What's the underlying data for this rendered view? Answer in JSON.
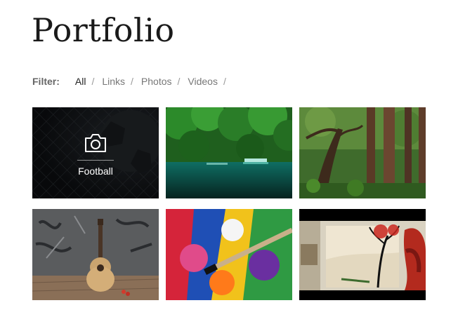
{
  "page": {
    "title": "Portfolio"
  },
  "filter": {
    "label": "Filter:",
    "separator": "/",
    "items": [
      {
        "label": "All",
        "active": true
      },
      {
        "label": "Links",
        "active": false
      },
      {
        "label": "Photos",
        "active": false
      },
      {
        "label": "Videos",
        "active": false
      }
    ]
  },
  "portfolio": {
    "items": [
      {
        "caption": "Football",
        "hover_icon": "camera-icon"
      },
      {
        "hover_icon": "camera-icon"
      },
      {
        "hover_icon": "camera-icon"
      },
      {
        "hover_icon": "camera-icon"
      },
      {
        "hover_icon": "camera-icon"
      },
      {
        "hover_icon": "camera-icon"
      }
    ]
  },
  "colors": {
    "title": "#1a1a1a",
    "filter_active": "#222222",
    "filter_inactive": "#777777",
    "overlay_text": "#ffffff"
  }
}
